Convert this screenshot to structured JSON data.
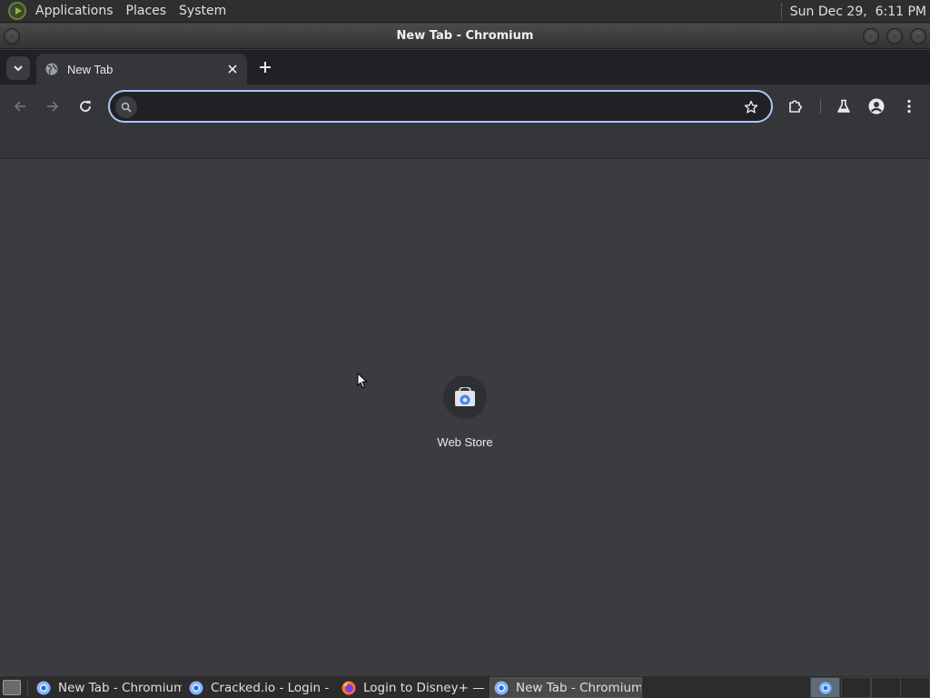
{
  "top_panel": {
    "menus": [
      "Applications",
      "Places",
      "System"
    ],
    "clock": "Sun Dec 29,  6:11 PM"
  },
  "window": {
    "title": "New Tab - Chromium"
  },
  "browser": {
    "tabs": [
      {
        "title": "New Tab",
        "icon": "globe-icon"
      }
    ],
    "omnibox": {
      "value": "",
      "placeholder": ""
    },
    "toolbar_icons": [
      "back-arrow-icon",
      "forward-arrow-icon",
      "reload-icon",
      "search-icon",
      "bookmark-star-icon",
      "extensions-puzzle-icon",
      "labs-flask-icon",
      "profile-icon",
      "more-menu-icon"
    ],
    "accent": "#a8c7fa"
  },
  "new_tab_page": {
    "shortcuts": [
      {
        "label": "Web Store",
        "icon": "web-store-icon"
      }
    ]
  },
  "taskbar": {
    "tasks": [
      {
        "label": "New Tab - Chromium",
        "icon": "chromium-icon",
        "active": false
      },
      {
        "label": "Cracked.io - Login - …",
        "icon": "chromium-icon",
        "active": false
      },
      {
        "label": "Login to Disney+ — …",
        "icon": "firefox-icon",
        "active": false
      },
      {
        "label": "New Tab - Chromium",
        "icon": "chromium-icon",
        "active": true
      }
    ]
  }
}
